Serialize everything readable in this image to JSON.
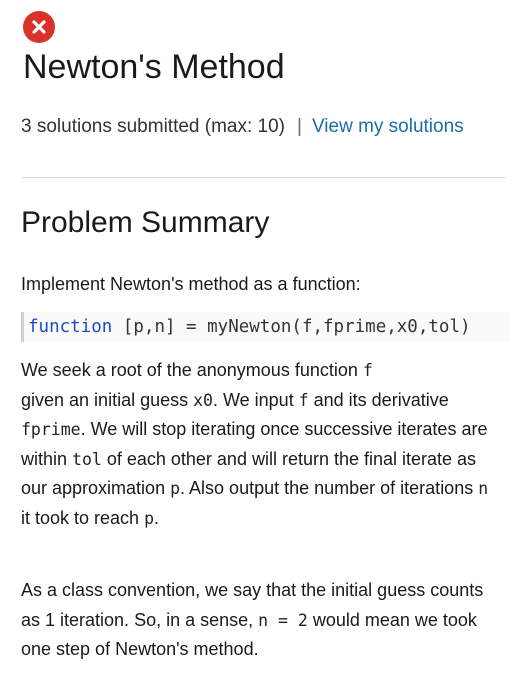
{
  "problem": {
    "status_icon": "x-circle-icon",
    "status_color": "#d8322b",
    "title": "Newton's Method"
  },
  "submissions": {
    "count_text": "3 solutions submitted (max: 10)",
    "separator": "|",
    "view_link": "View my solutions",
    "link_color": "#1b6ea5"
  },
  "summary": {
    "heading": "Problem Summary",
    "intro": "Implement Newton's method as a function:",
    "code": {
      "keyword": "function",
      "rest": " [p,n] = myNewton(f,fprime,x0,tol)",
      "keyword_color": "#1f48c7"
    },
    "paragraph1": {
      "t1": "We seek a root of the anonymous function ",
      "c1": "f",
      "t2": " given an initial guess ",
      "c2": "x0",
      "t3": ". We input ",
      "c3": "f",
      "t4": " and its derivative ",
      "c4": "fprime",
      "t5": ". We will stop iterating once successive iterates are within ",
      "c5": "tol",
      "t6": " of each other and will return the final iterate as our approximation ",
      "c6": "p",
      "t7": ".  Also output the number of iterations ",
      "c7": "n",
      "t8": " it took to reach ",
      "c8": "p",
      "t9": "."
    },
    "paragraph2": {
      "t1": "As a class convention, we say that the initial guess counts as 1 iteration.  So, in a sense, ",
      "c1": "n = 2",
      "t2": " would mean we took one step of Newton's method."
    }
  }
}
